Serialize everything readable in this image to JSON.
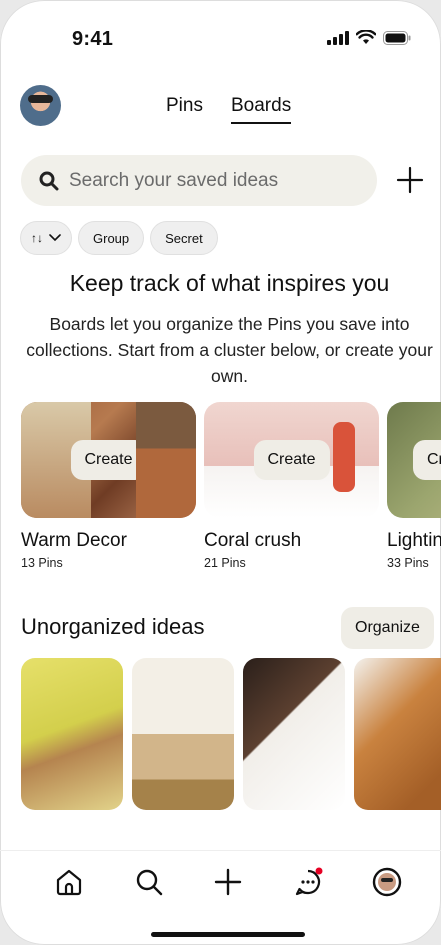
{
  "status_bar": {
    "time": "9:41"
  },
  "header": {
    "tabs": [
      {
        "label": "Pins"
      },
      {
        "label": "Boards"
      }
    ]
  },
  "search": {
    "placeholder": "Search your saved ideas"
  },
  "filters": [
    {
      "label": "↑↓"
    },
    {
      "label": "Group"
    },
    {
      "label": "Secret"
    }
  ],
  "empty_state": {
    "headline": "Keep track of what inspires you",
    "body": "Boards let you organize the Pins you save into collections. Start from a cluster below, or create your own."
  },
  "clusters": [
    {
      "name": "Warm Decor",
      "count": "13 Pins",
      "action": "Create"
    },
    {
      "name": "Coral crush",
      "count": "21 Pins",
      "action": "Create"
    },
    {
      "name": "Lightin",
      "count": "33 Pins",
      "action": "Create"
    }
  ],
  "unorganized": {
    "title": "Unorganized ideas",
    "organize_label": "Organize"
  },
  "bottom_nav": [
    {
      "icon": "home-icon"
    },
    {
      "icon": "search-icon"
    },
    {
      "icon": "plus-icon"
    },
    {
      "icon": "messages-icon",
      "badge": true
    },
    {
      "icon": "profile-icon"
    }
  ],
  "colors": {
    "accent_badge": "#e60023",
    "chip_bg": "#efefef",
    "search_bg": "#f1f0ea"
  }
}
